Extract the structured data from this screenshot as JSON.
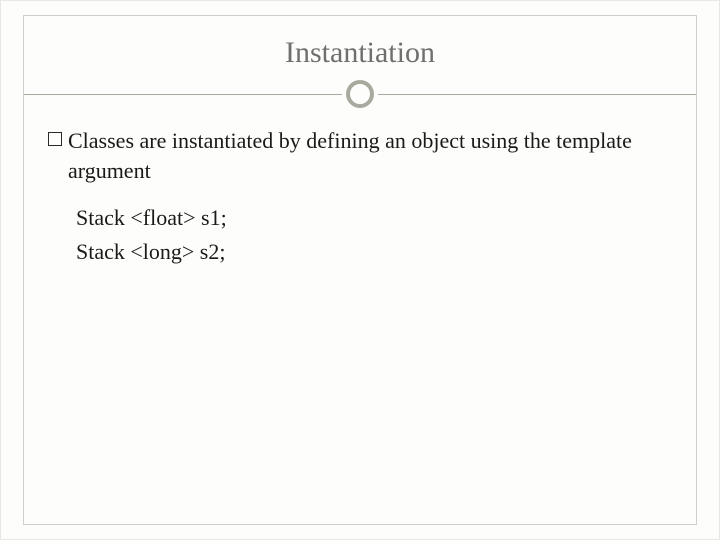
{
  "slide": {
    "title": "Instantiation",
    "bullet": "Classes are instantiated by defining an object using the template argument",
    "code1": "Stack <float> s1;",
    "code2": "Stack <long> s2;"
  }
}
